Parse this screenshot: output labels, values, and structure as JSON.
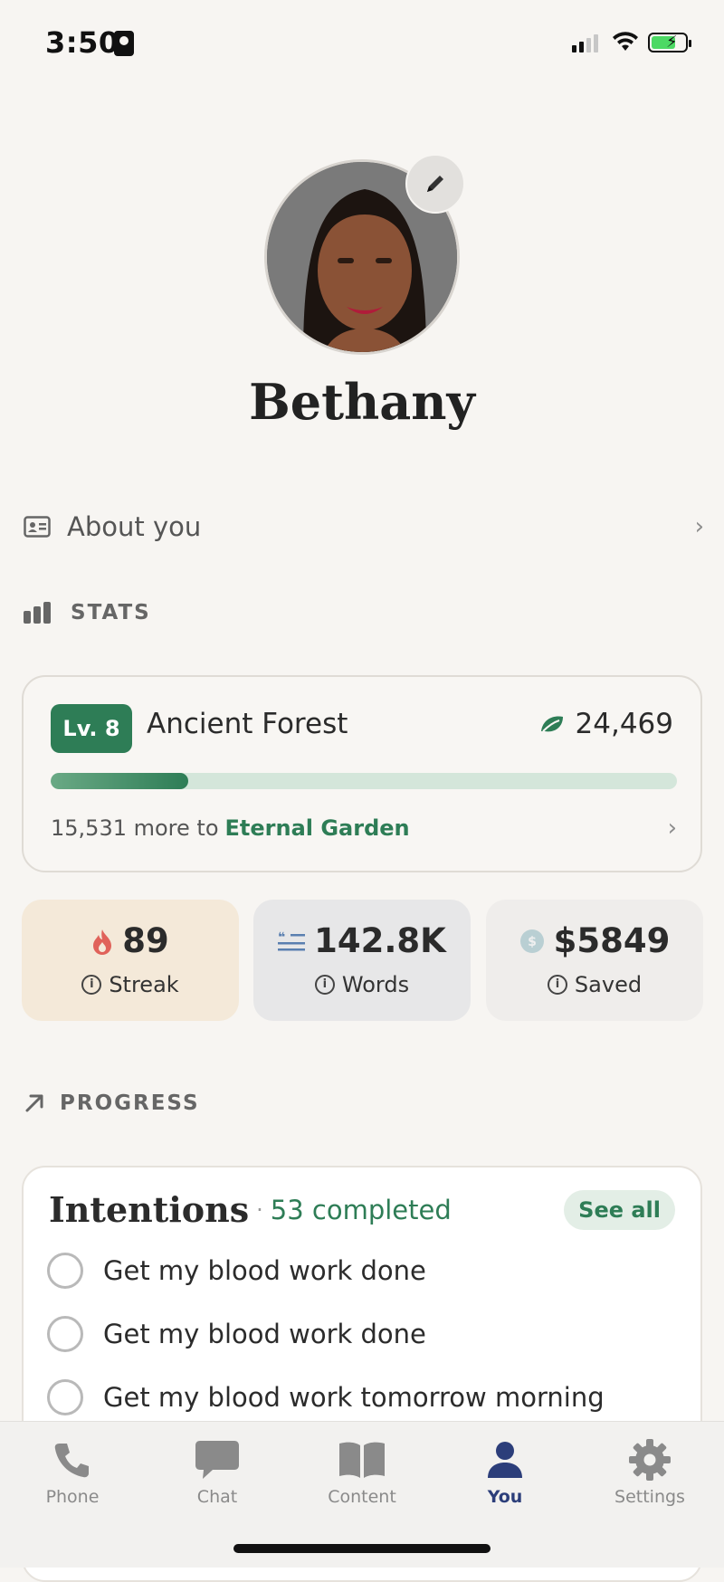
{
  "status_bar": {
    "time": "3:50"
  },
  "profile": {
    "name": "Bethany"
  },
  "about": {
    "label": "About you"
  },
  "stats_section": {
    "title": "STATS"
  },
  "level": {
    "badge": "Lv. 8",
    "name": "Ancient Forest",
    "points": "24,469",
    "progress_fraction": 0.22,
    "remaining_text": "15,531 more to",
    "next_level": "Eternal Garden"
  },
  "tiles": [
    {
      "value": "89",
      "label": "Streak",
      "icon": "flame-icon"
    },
    {
      "value": "142.8K",
      "label": "Words",
      "icon": "quote-lines-icon"
    },
    {
      "value": "$5849",
      "label": "Saved",
      "icon": "dollar-coin-icon"
    }
  ],
  "progress_section": {
    "title": "PROGRESS"
  },
  "intentions": {
    "title": "Intentions",
    "completed": "53 completed",
    "see_all": "See all",
    "items": [
      "Get my blood work done",
      "Get my blood work done",
      "Get my blood work tomorrow morning"
    ]
  },
  "tabbar": {
    "tabs": [
      {
        "label": "Phone"
      },
      {
        "label": "Chat"
      },
      {
        "label": "Content"
      },
      {
        "label": "You"
      },
      {
        "label": "Settings"
      }
    ],
    "active": "You"
  },
  "colors": {
    "accent_green": "#2e7d56",
    "active_tab": "#2c3e7a",
    "streak_tile": "#f4e9d9",
    "words_tile": "#e7e7e8",
    "saved_tile": "#efedeb"
  }
}
